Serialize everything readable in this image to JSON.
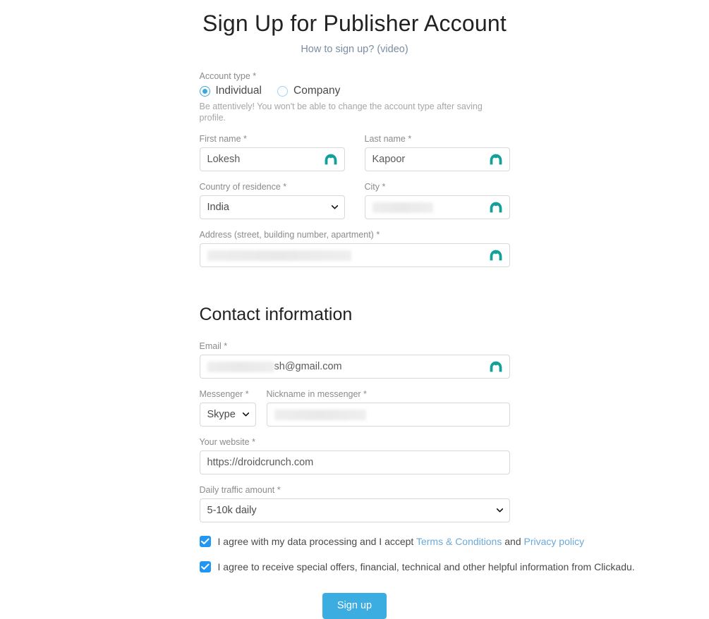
{
  "header": {
    "title": "Sign Up for Publisher Account",
    "subtitle_link": "How to sign up? (video)"
  },
  "account_type": {
    "label": "Account type *",
    "options": [
      {
        "label": "Individual",
        "selected": true
      },
      {
        "label": "Company",
        "selected": false
      }
    ],
    "hint": "Be attentively! You won't be able to change the account type after saving profile."
  },
  "fields": {
    "first_name": {
      "label": "First name *",
      "value": "Lokesh",
      "redacted": false
    },
    "last_name": {
      "label": "Last name *",
      "value": "Kapoor",
      "redacted": false
    },
    "country": {
      "label": "Country of residence *",
      "value": "India"
    },
    "city": {
      "label": "City *",
      "value": "",
      "redacted": true
    },
    "address": {
      "label": "Address (street, building number, apartment) *",
      "value": "",
      "redacted": true
    }
  },
  "contact": {
    "section_title": "Contact information",
    "email": {
      "label": "Email *",
      "value": "sh@gmail.com",
      "redacted_prefix": true
    },
    "messenger": {
      "label": "Messenger *",
      "value": "Skype"
    },
    "nickname": {
      "label": "Nickname in messenger *",
      "value": "",
      "redacted": true
    },
    "website": {
      "label": "Your website *",
      "value": "https://droidcrunch.com"
    },
    "traffic": {
      "label": "Daily traffic amount *",
      "value": "5-10k daily"
    }
  },
  "agreements": [
    {
      "checked": true,
      "text_before": "I agree with my data processing and I accept",
      "link1": "Terms & Conditions",
      "text_between": "and",
      "link2": "Privacy policy"
    },
    {
      "checked": true,
      "text_before": "I agree to receive special offers, financial, technical and other helpful information from Clickadu."
    }
  ],
  "submit": {
    "label": "Sign up"
  },
  "colors": {
    "accent": "#3cade0",
    "checkbox": "#2196f3",
    "link": "#6aa9d8",
    "nordpass": "#11a19a"
  }
}
